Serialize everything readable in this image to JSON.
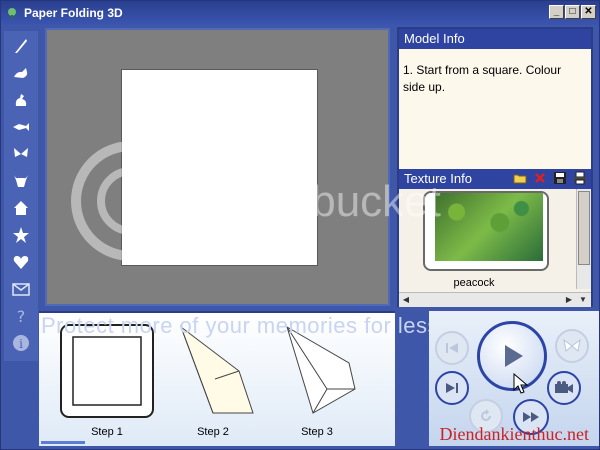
{
  "window": {
    "title": "Paper Folding 3D",
    "min_label": "_",
    "max_label": "□",
    "close_label": "✕"
  },
  "toolbar": {
    "tools": [
      "quill-icon",
      "fox-icon",
      "rooster-icon",
      "fish-icon",
      "butterfly-icon",
      "bull-icon",
      "house-icon",
      "star-icon",
      "heart-icon",
      "envelope-icon",
      "help-icon",
      "info-icon"
    ]
  },
  "model_info": {
    "header": "Model Info",
    "text": "1. Start from a square. Colour side up."
  },
  "texture_info": {
    "header": "Texture Info",
    "texture_name": "peacock"
  },
  "steps": [
    {
      "label": "Step 1"
    },
    {
      "label": "Step 2"
    },
    {
      "label": "Step 3"
    }
  ],
  "overlay": {
    "banner": "Protect more of your memories for less!",
    "credit": "Diendankienthuc.net",
    "watermark": "photobucket"
  },
  "colors": {
    "window_blue": "#3f57a8",
    "header_blue": "#2f44a0",
    "canvas_gray": "#7f7f7f"
  }
}
